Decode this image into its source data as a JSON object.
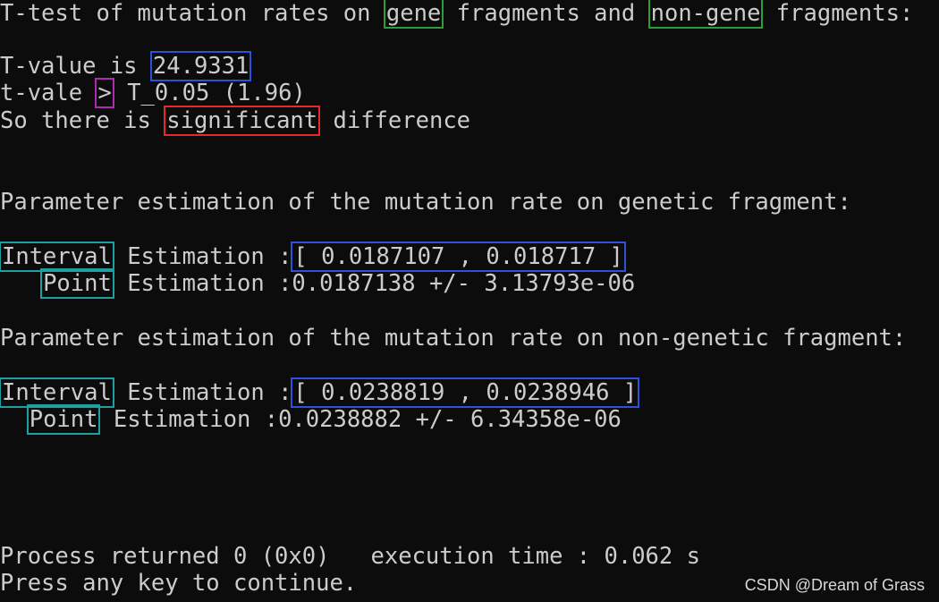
{
  "colors": {
    "background": "#0c0c0c",
    "text": "#cccccc",
    "box_green": "#2e9c3a",
    "box_blue": "#2f50d8",
    "box_magenta": "#b02ab0",
    "box_red": "#e02c2c",
    "box_teal": "#1fa0a0"
  },
  "console": {
    "title_line": {
      "part1": "T-test of mutation rates on",
      "gene": "gene",
      "part2": "fragments and",
      "non_gene": "non-gene",
      "part3": "fragments:"
    },
    "tvalue_line": {
      "label": "T-value is",
      "value": "24.9331"
    },
    "compare_line": {
      "label": "t-vale",
      "operator": ">",
      "threshold": "T_0.05 (1.96)"
    },
    "conclusion_line": {
      "prefix": "So there is",
      "keyword": "significant",
      "suffix": "difference"
    },
    "genetic": {
      "heading": "Parameter estimation of the mutation rate on genetic fragment:",
      "interval_label": "Interval",
      "interval_text": "Estimation :",
      "interval_value": "[ 0.0187107 , 0.018717 ]",
      "point_label": "Point",
      "point_text": "Estimation :0.0187138 +/- 3.13793e-06"
    },
    "nongenetic": {
      "heading": "Parameter estimation of the mutation rate on non-genetic fragment:",
      "interval_label": "Interval",
      "interval_text": "Estimation :",
      "interval_value": "[ 0.0238819 , 0.0238946 ]",
      "point_label": "Point",
      "point_text": "Estimation :0.0238882 +/- 6.34358e-06"
    },
    "process_line": "Process returned 0 (0x0)   execution time : 0.062 s",
    "press_line": "Press any key to continue."
  },
  "watermark": "CSDN @Dream of Grass"
}
